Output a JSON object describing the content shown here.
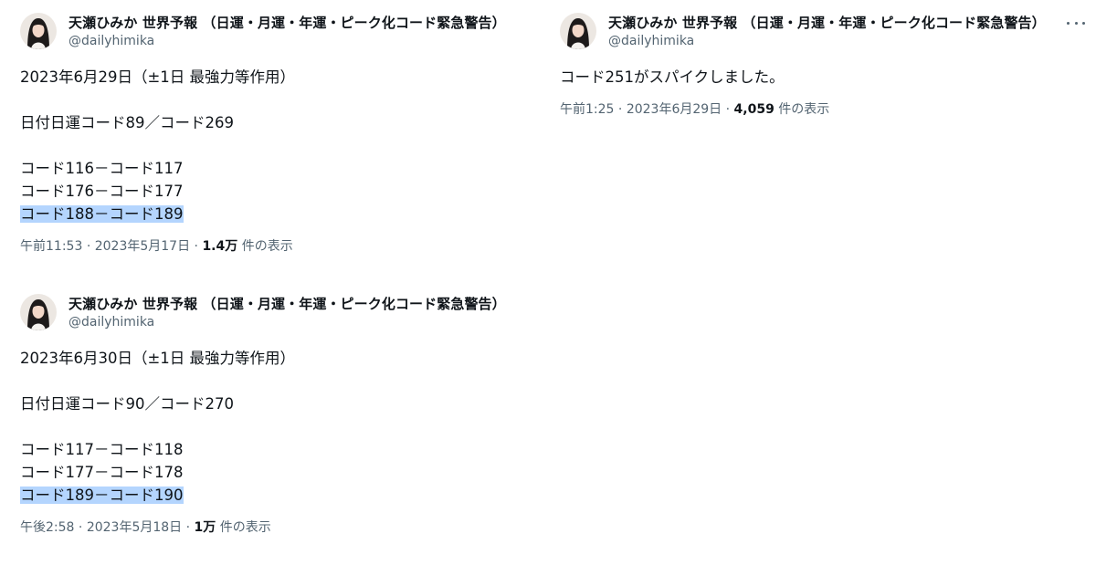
{
  "tweets": [
    {
      "display_name": "天瀬ひみか 世界予報 （日運・月運・年運・ピーク化コード緊急警告）",
      "handle": "@dailyhimika",
      "lines": [
        "2023年6月29日（±1日 最強力等作用）",
        "",
        "日付日運コード89／コード269",
        "",
        "コード116－コード117",
        "コード176－コード177",
        "コード188－コード189"
      ],
      "highlighted_line": "コード188－コード189",
      "time": "午前11:53",
      "date": "2023年5月17日",
      "views": "1.4万",
      "views_suffix": "件の表示"
    },
    {
      "display_name": "天瀬ひみか 世界予報 （日運・月運・年運・ピーク化コード緊急警告）",
      "handle": "@dailyhimika",
      "lines": [
        "2023年6月30日（±1日 最強力等作用）",
        "",
        "日付日運コード90／コード270",
        "",
        "コード117－コード118",
        "コード177－コード178",
        "コード189－コード190"
      ],
      "highlighted_line": "コード189－コード190",
      "time": "午後2:58",
      "date": "2023年5月18日",
      "views": "1万",
      "views_suffix": "件の表示"
    },
    {
      "display_name": "天瀬ひみか 世界予報 （日運・月運・年運・ピーク化コード緊急警告）",
      "handle": "@dailyhimika",
      "lines": [
        "コード251がスパイクしました。"
      ],
      "time": "午前1:25",
      "date": "2023年6月29日",
      "views": "4,059",
      "views_suffix": "件の表示"
    }
  ],
  "meta_separator": "·",
  "colors": {
    "text": "#0f1419",
    "secondary": "#536471",
    "highlight": "#b4d5fe"
  },
  "icons": {
    "avatar": "profile-photo",
    "more": "more-horizontal-icon"
  }
}
